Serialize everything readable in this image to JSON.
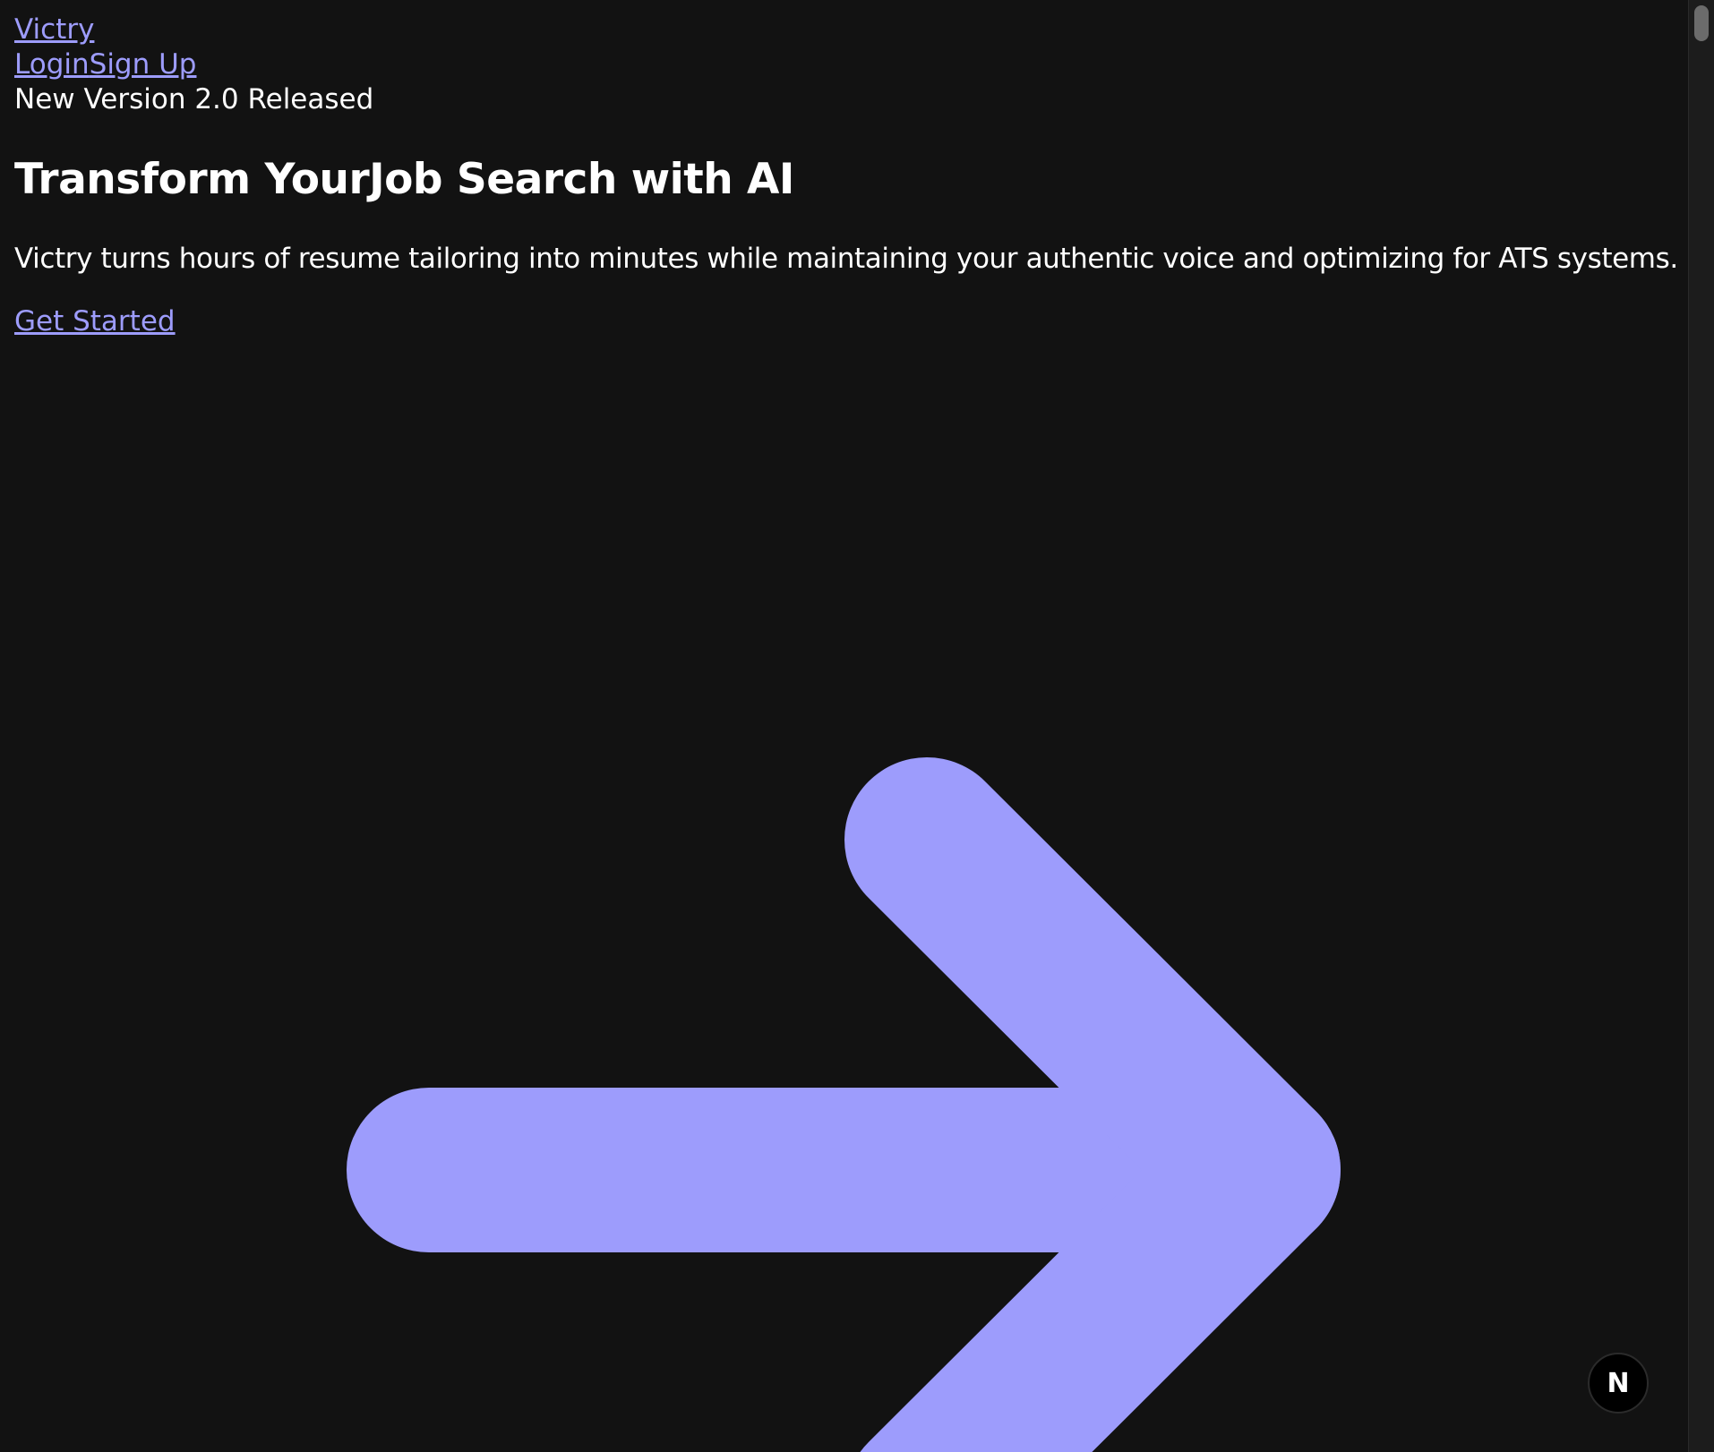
{
  "nav": {
    "brand": "Victry",
    "login_label": "Login",
    "signup_label": "Sign Up"
  },
  "banner": {
    "text": "New Version 2.0 Released"
  },
  "hero": {
    "title": "Transform YourJob Search with AI",
    "subtitle": "Victry turns hours of resume tailoring into minutes while maintaining your authentic voice and optimizing for ATS systems.",
    "cta_label": "Get Started"
  },
  "badge": {
    "label": "N"
  },
  "colors": {
    "background": "#121212",
    "accent": "#9d9cfc",
    "text": "#ffffff"
  },
  "icons": {
    "hero_arrow": "arrow-right-icon",
    "dev_badge": "nextjs-icon"
  }
}
